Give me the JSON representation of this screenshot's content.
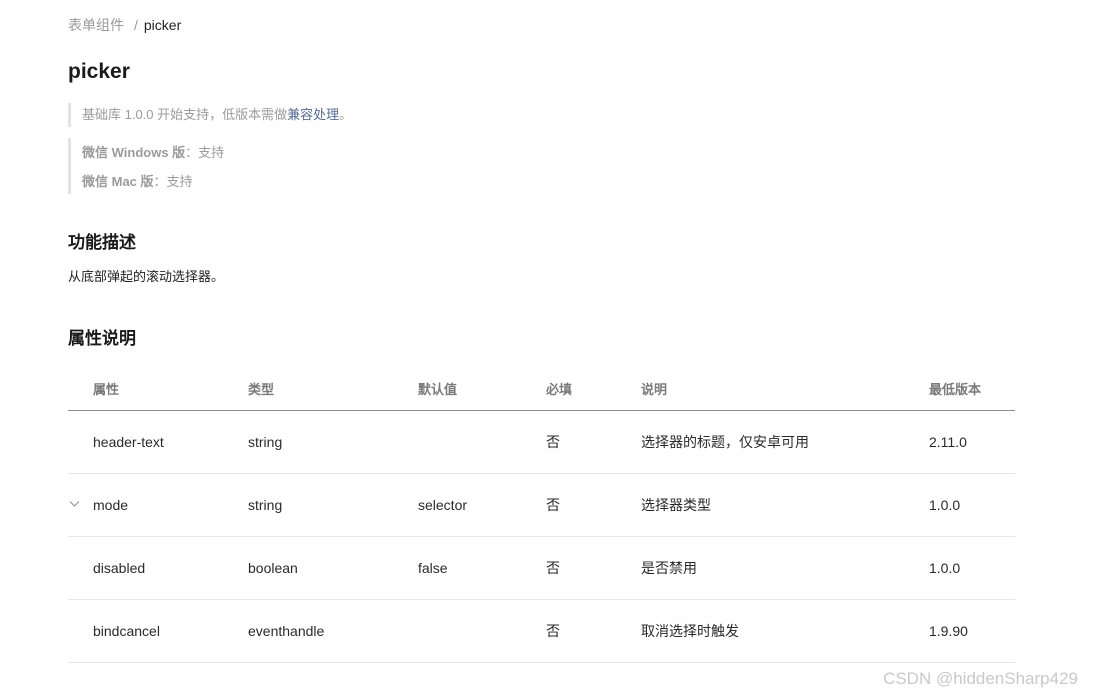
{
  "breadcrumb": {
    "parent": "表单组件",
    "separator": "/",
    "current": "picker"
  },
  "page": {
    "title": "picker"
  },
  "notices": {
    "support_prefix": "基础库 1.0.0 开始支持，低版本需做",
    "support_link": "兼容处理",
    "support_suffix": "。",
    "windows_label": "微信 Windows 版",
    "windows_value": "：支持",
    "mac_label": "微信 Mac 版",
    "mac_value": "：支持"
  },
  "sections": {
    "feature_title": "功能描述",
    "feature_desc": "从底部弹起的滚动选择器。",
    "props_title": "属性说明"
  },
  "table": {
    "headers": [
      "属性",
      "类型",
      "默认值",
      "必填",
      "说明",
      "最低版本"
    ],
    "rows": [
      {
        "name": "header-text",
        "type": "string",
        "default": "",
        "required": "否",
        "desc": "选择器的标题，仅安卓可用",
        "version": "2.11.0"
      },
      {
        "name": "mode",
        "type": "string",
        "default": "selector",
        "required": "否",
        "desc": "选择器类型",
        "version": "1.0.0",
        "expandable": true
      },
      {
        "name": "disabled",
        "type": "boolean",
        "default": "false",
        "required": "否",
        "desc": "是否禁用",
        "version": "1.0.0"
      },
      {
        "name": "bindcancel",
        "type": "eventhandle",
        "default": "",
        "required": "否",
        "desc": "取消选择时触发",
        "version": "1.9.90"
      }
    ]
  },
  "watermark": "CSDN @hiddenSharp429",
  "colors": {
    "link": "#576b95",
    "muted": "#9b9b9b",
    "border": "#e6e6e6"
  },
  "icons": {
    "expand": "chevron-down-icon"
  }
}
